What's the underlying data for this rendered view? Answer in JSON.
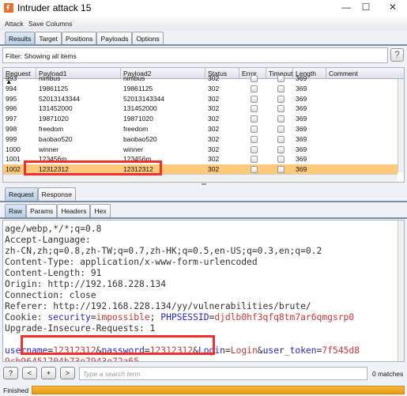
{
  "window": {
    "title": "Intruder attack 15",
    "minimize": "—",
    "maximize": "☐",
    "close": "✕"
  },
  "menu": [
    "Attack",
    "Save",
    "Columns"
  ],
  "tabs": [
    "Results",
    "Target",
    "Positions",
    "Payloads",
    "Options"
  ],
  "filter": {
    "text": "Filter: Showing all items",
    "help": "?"
  },
  "table": {
    "columns": [
      "Request ▲",
      "Payload1",
      "Payload2",
      "Status",
      "Error",
      "Timeout",
      "Length",
      "Comment"
    ],
    "rows": [
      {
        "req": "993",
        "p1": "nimbus",
        "p2": "nimbus",
        "status": "302",
        "len": "369"
      },
      {
        "req": "994",
        "p1": "19861125",
        "p2": "19861125",
        "status": "302",
        "len": "369"
      },
      {
        "req": "995",
        "p1": "52013143344",
        "p2": "52013143344",
        "status": "302",
        "len": "369"
      },
      {
        "req": "996",
        "p1": "131452000",
        "p2": "131452000",
        "status": "302",
        "len": "369"
      },
      {
        "req": "997",
        "p1": "19871020",
        "p2": "19871020",
        "status": "302",
        "len": "369"
      },
      {
        "req": "998",
        "p1": "freedom",
        "p2": "freedom",
        "status": "302",
        "len": "369"
      },
      {
        "req": "999",
        "p1": "baobao520",
        "p2": "baobao520",
        "status": "302",
        "len": "369"
      },
      {
        "req": "1000",
        "p1": "winner",
        "p2": "winner",
        "status": "302",
        "len": "369"
      },
      {
        "req": "1001",
        "p1": "123456m",
        "p2": "123456m",
        "status": "302",
        "len": "369"
      },
      {
        "req": "1002",
        "p1": "12312312",
        "p2": "12312312",
        "status": "302",
        "len": "369",
        "selected": true
      }
    ]
  },
  "detail_tabs": [
    "Request",
    "Response"
  ],
  "sub_tabs": [
    "Raw",
    "Params",
    "Headers",
    "Hex"
  ],
  "request_lines": [
    "age/webp,*/*;q=0.8",
    "Accept-Language:",
    "zh-CN,zh;q=0.8,zh-TW;q=0.7,zh-HK;q=0.5,en-US;q=0.3,en;q=0.2",
    "Content-Type: application/x-www-form-urlencoded",
    "Content-Length: 91",
    "Origin: http://192.168.228.134",
    "Connection: close",
    "Referer: http://192.168.228.134/yy/vulnerabilities/brute/"
  ],
  "cookie": {
    "label": "Cookie: ",
    "k1": "security",
    "eq": "=",
    "v1": "impossible",
    "sep": "; ",
    "k2": "PHPSESSID",
    "v2": "djdlb0hf3qfq8tm7ar6qmgsrp0"
  },
  "upgrade": "Upgrade-Insecure-Requests: 1",
  "body": {
    "k1": "username",
    "v1": "12312312",
    "amp": "&",
    "k2": "password",
    "v2": "12312312",
    "k3": "Login",
    "v3": "Login",
    "k4": "user_token",
    "v4": "7f545d8",
    "cont": "9cb96451704b73e7943e72a65"
  },
  "search": {
    "buttons": [
      "?",
      "<",
      "+",
      ">"
    ],
    "placeholder": "Type a search term",
    "matches": "0 matches"
  },
  "status": {
    "text": "Finished",
    "progress": 100
  },
  "colors": {
    "selected_row": "#fdc97a",
    "highlight_box": "#f0302d",
    "param_name": "#2727c8",
    "param_value": "#c8383a",
    "progress": "#f0a82a"
  }
}
